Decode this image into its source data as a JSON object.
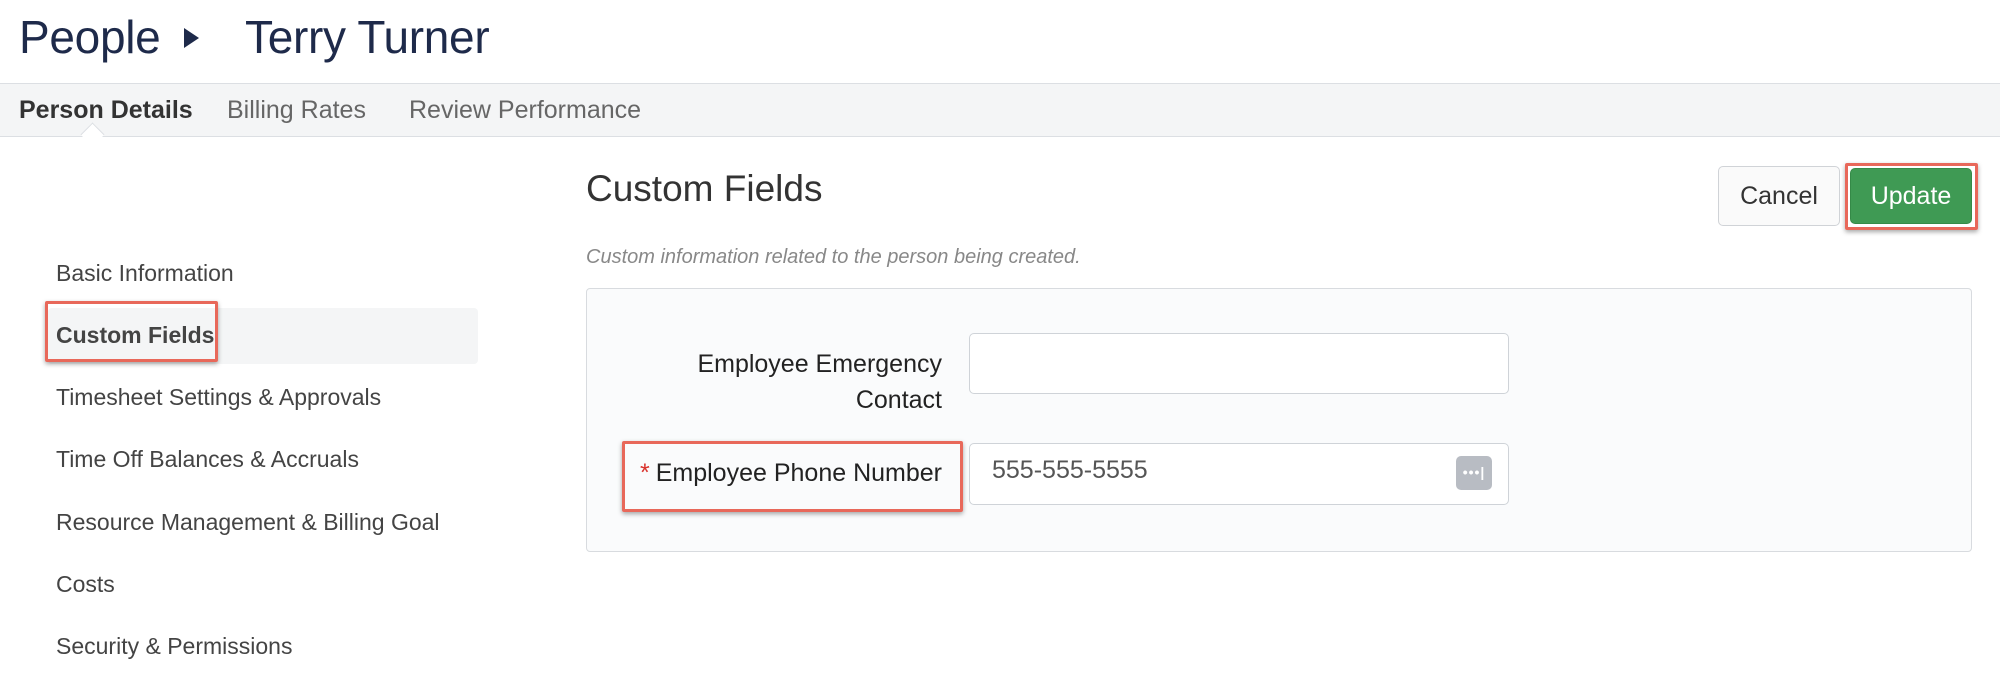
{
  "breadcrumb": {
    "root": "People",
    "current": "Terry Turner"
  },
  "tabs": [
    {
      "label": "Person Details",
      "active": true
    },
    {
      "label": "Billing Rates",
      "active": false
    },
    {
      "label": "Review Performance",
      "active": false
    }
  ],
  "sidebar": {
    "items": [
      {
        "label": "Basic Information",
        "active": false
      },
      {
        "label": "Custom Fields",
        "active": true
      },
      {
        "label": "Timesheet Settings & Approvals",
        "active": false
      },
      {
        "label": "Time Off Balances & Accruals",
        "active": false
      },
      {
        "label": "Resource Management & Billing Goal",
        "active": false
      },
      {
        "label": "Costs",
        "active": false
      },
      {
        "label": "Security & Permissions",
        "active": false
      }
    ]
  },
  "section": {
    "title": "Custom Fields",
    "description": "Custom information related to the person being created."
  },
  "actions": {
    "cancel_label": "Cancel",
    "update_label": "Update"
  },
  "fields": {
    "emergency_contact": {
      "label_line1": "Employee Emergency",
      "label_line2": "Contact",
      "value": ""
    },
    "phone_number": {
      "required_marker": "*",
      "label": "Employee Phone Number",
      "value": "555-555-5555",
      "icon": "more-options-icon"
    }
  },
  "colors": {
    "accent_green": "#3f9a54",
    "highlight_red": "#e8685a",
    "heading_navy": "#1e2a4a"
  }
}
